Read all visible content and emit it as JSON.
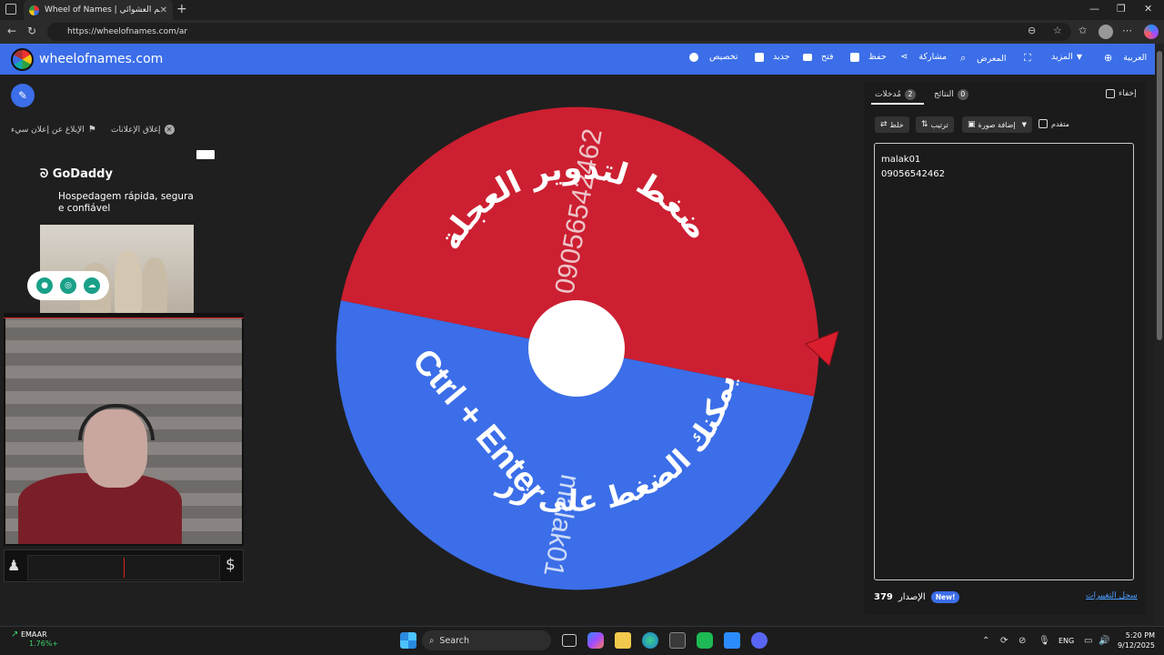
{
  "browser": {
    "tab_title": "Wheel of Names | الاسم العشوائي",
    "url": "https://wheelofnames.com/ar"
  },
  "header": {
    "site_name": "wheelofnames.com",
    "menu": {
      "customize": "تخصيص",
      "new": "جديد",
      "open": "فتح",
      "save": "حفظ",
      "share": "مشاركة",
      "gallery": "المعرض",
      "more": "المزيد",
      "language": "العربية"
    }
  },
  "ads": {
    "close_ads": "إغلاق الإعلانات",
    "report_ad": "الإبلاغ عن إعلان سيء",
    "brand": "GoDaddy",
    "text": "Hospedagem rápida, segura e confiável"
  },
  "wheel": {
    "segments": [
      {
        "label": "09056542462",
        "color": "#cc1f31"
      },
      {
        "label": "malak01",
        "color": "#3b6ee8"
      }
    ],
    "instruction_top": "اضغط لتدوير العجلة",
    "instruction_bottom": "أو يمكنك الضغط على زر",
    "shortcut": "Ctrl + Enter",
    "pointer_color": "#d91e2e"
  },
  "panel": {
    "tabs": {
      "entries_label": "مُدخلات",
      "entries_count": "2",
      "results_label": "النتائج",
      "results_count": "0"
    },
    "hide_label": "إخفاء",
    "tools": {
      "shuffle": "خلط",
      "sort": "ترتيب",
      "add_image": "إضافة صورة",
      "advanced": "متقدم"
    },
    "entries_text": [
      "malak01",
      "09056542462"
    ],
    "version_label": "الإصدار",
    "version_number": "379",
    "new_badge": "New!",
    "changelog": "سجل التغييرات"
  },
  "taskbar": {
    "stock_name": "EMAAR",
    "stock_change": "1.76%+",
    "search_placeholder": "Search",
    "lang": "ENG",
    "time": "5:20 PM",
    "date": "9/12/2025"
  }
}
